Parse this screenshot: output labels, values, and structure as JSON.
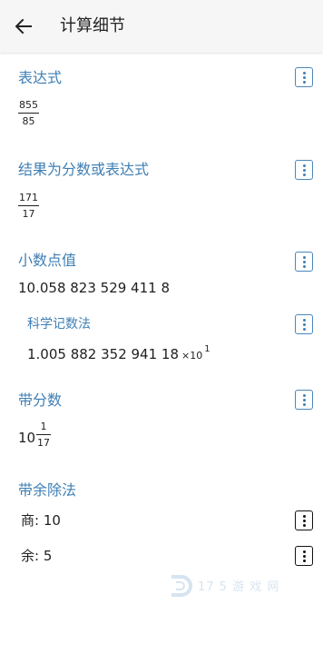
{
  "header": {
    "title": "计算细节"
  },
  "sections": {
    "expression": {
      "title": "表达式",
      "numerator": "855",
      "denominator": "85"
    },
    "result": {
      "title": "结果为分数或表达式",
      "numerator": "171",
      "denominator": "17"
    },
    "decimal": {
      "title": "小数点值",
      "value": "10.058 823 529 411 8",
      "scientific": {
        "title": "科学记数法",
        "mantissa": "1.005 882 352 941 18",
        "times_base": "×10",
        "exponent": "1"
      }
    },
    "mixed": {
      "title": "带分数",
      "whole": "10",
      "numerator": "1",
      "denominator": "17"
    },
    "division": {
      "title": "带余除法",
      "quotient_label": "商: 10",
      "remainder_label": "余: 5"
    }
  },
  "watermark": {
    "text": "17 5 游 戏 网"
  },
  "icons": {
    "back": "arrow-left-icon",
    "menu": "more-vertical-icon"
  },
  "colors": {
    "accent": "#3f7fb4",
    "appbar": "#f6f6f6"
  }
}
